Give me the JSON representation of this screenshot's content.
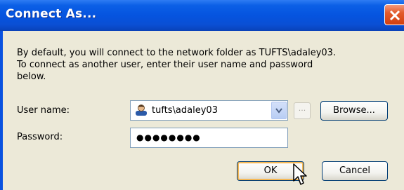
{
  "dialog": {
    "title": "Connect As...",
    "message": "By default, you will connect to the network folder as TUFTS\\adaley03. To connect as another user, enter their user name and password below."
  },
  "form": {
    "username_label": "User name:",
    "username_value": "tufts\\adaley03",
    "more_label": "...",
    "browse_label": "Browse...",
    "password_label": "Password:",
    "password_value": "●●●●●●●●"
  },
  "buttons": {
    "ok_label": "OK",
    "cancel_label": "Cancel"
  },
  "colors": {
    "titlebar": "#0554df",
    "client": "#ece9d8",
    "close": "#d23f0f",
    "default_button_focus": "#f6b855"
  },
  "icons": {
    "close": "close-icon",
    "user": "user-icon",
    "dropdown": "chevron-down-icon",
    "cursor": "mouse-pointer-icon"
  }
}
